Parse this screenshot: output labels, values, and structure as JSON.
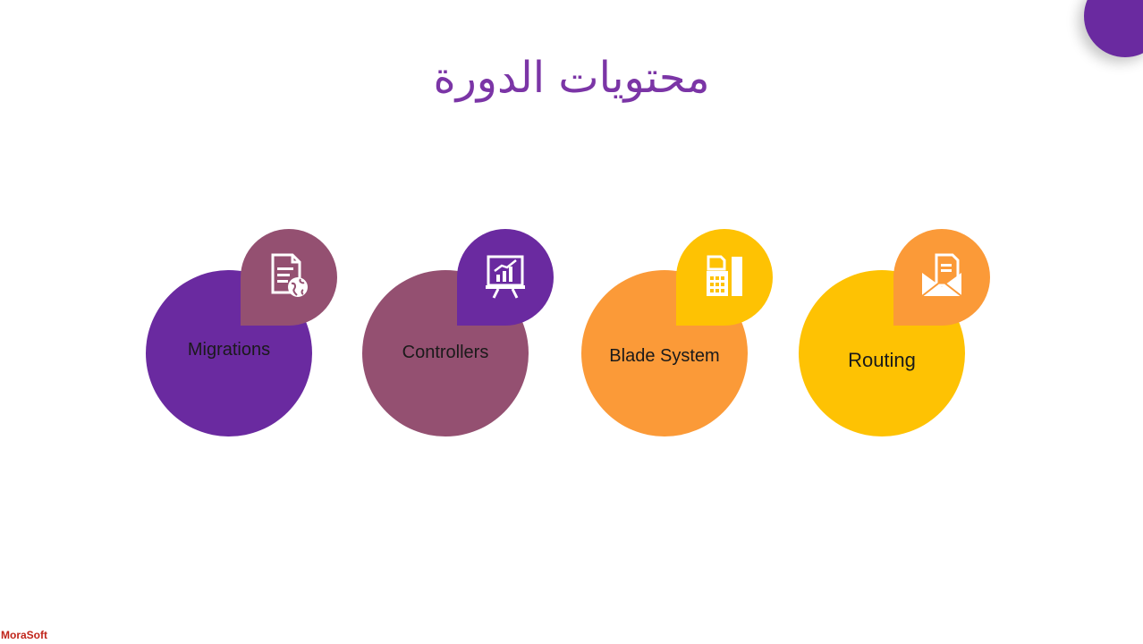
{
  "slide": {
    "title": "محتويات الدورة",
    "title_color": "#7b35a6",
    "corner_dot_color": "#6a2aa0"
  },
  "items": [
    {
      "label": "Migrations",
      "circle_color": "#6a2aa0",
      "badge_color": "#945071",
      "icon": "document-globe-icon"
    },
    {
      "label": "Controllers",
      "circle_color": "#945071",
      "badge_color": "#6a2aa0",
      "icon": "presentation-chart-icon"
    },
    {
      "label": "Blade System",
      "circle_color": "#fb9a38",
      "badge_color": "#fec203",
      "icon": "fax-machine-icon"
    },
    {
      "label": "Routing",
      "circle_color": "#fec203",
      "badge_color": "#fb9a38",
      "icon": "envelope-document-icon"
    }
  ],
  "watermark": "MoraSoft"
}
